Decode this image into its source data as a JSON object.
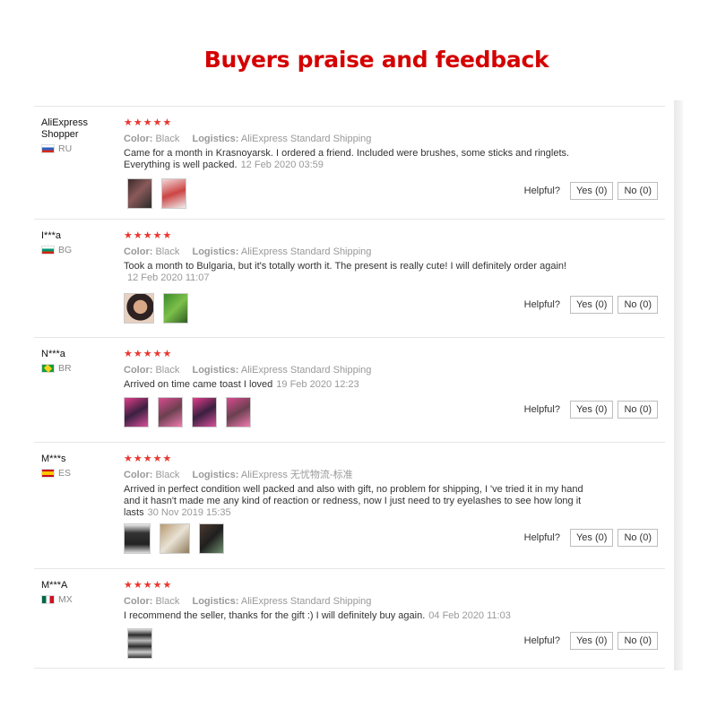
{
  "title": "Buyers praise and feedback",
  "labels": {
    "color": "Color:",
    "logistics": "Logistics:",
    "helpful": "Helpful?"
  },
  "reviews": [
    {
      "buyer": "AliExpress Shopper",
      "country": "RU",
      "stars": "★★★★★",
      "color": "Black",
      "logistics": "AliExpress Standard Shipping",
      "text": "Came for a month in Krasnoyarsk. I ordered a friend. Included were brushes, some sticks and ringlets. Everything is well packed.",
      "date": "12 Feb 2020 03:59",
      "yes": "Yes (0)",
      "no": "No (0)"
    },
    {
      "buyer": "I***a",
      "country": "BG",
      "stars": "★★★★★",
      "color": "Black",
      "logistics": "AliExpress Standard Shipping",
      "text": "Took a month to Bulgaria, but it's totally worth it. The present is really cute! I will definitely order again!",
      "date": "12 Feb 2020 11:07",
      "yes": "Yes (0)",
      "no": "No (0)"
    },
    {
      "buyer": "N***a",
      "country": "BR",
      "stars": "★★★★★",
      "color": "Black",
      "logistics": "AliExpress Standard Shipping",
      "text": "Arrived on time came toast I loved",
      "date": "19 Feb 2020 12:23",
      "yes": "Yes (0)",
      "no": "No (0)"
    },
    {
      "buyer": "M***s",
      "country": "ES",
      "stars": "★★★★★",
      "color": "Black",
      "logistics": "AliExpress 无忧物流-标准",
      "text": "Arrived in perfect condition well packed and also with gift, no problem for shipping, I 've tried it in my hand and it hasn't made me any kind of reaction or redness, now I just need to try eyelashes to see how long it lasts",
      "date": "30 Nov 2019 15:35",
      "yes": "Yes (0)",
      "no": "No (0)"
    },
    {
      "buyer": "M***A",
      "country": "MX",
      "stars": "★★★★★",
      "color": "Black",
      "logistics": "AliExpress Standard Shipping",
      "text": "I recommend the seller, thanks for the gift :) I will definitely buy again.",
      "date": "04 Feb 2020 11:03",
      "yes": "Yes (0)",
      "no": "No (0)"
    }
  ]
}
